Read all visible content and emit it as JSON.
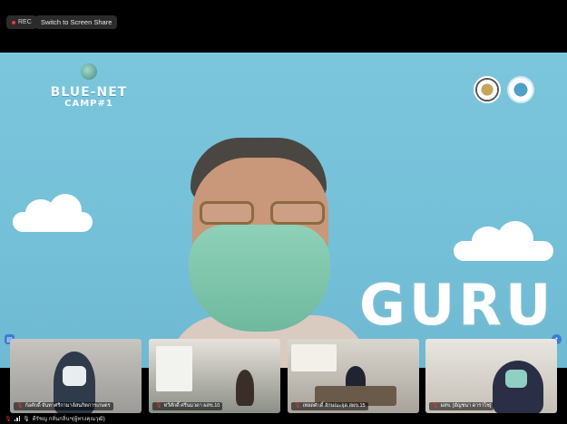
{
  "topbar": {
    "rec_label": "REC",
    "switch_label": "Switch to Screen Share"
  },
  "stage": {
    "logo_word": "BLUE-NET",
    "logo_sub": "CAMP#1",
    "guru_text": "GURU"
  },
  "thumbnails": [
    {
      "name": "ก้อศักดิ์ จันทาศรีกามาล์สนกิตการเกษตร"
    },
    {
      "name": "ทวีศักดิ์ ศรีนมวดา  ผสข.10"
    },
    {
      "name": "เทอดศักดิ์  ลักษณะจุด สผข.15"
    },
    {
      "name": "ผสข. [อัญชนา ดาราไช]"
    }
  ],
  "status": {
    "user_label": "ดีรัชญ กลั่นกลิ่นฯ(ผู้ทรงคุณวุฒิ)"
  },
  "colors": {
    "accent": "#3b7bd6",
    "rec_dot": "#e8383a",
    "stage_bg": "#7cc6dc"
  }
}
